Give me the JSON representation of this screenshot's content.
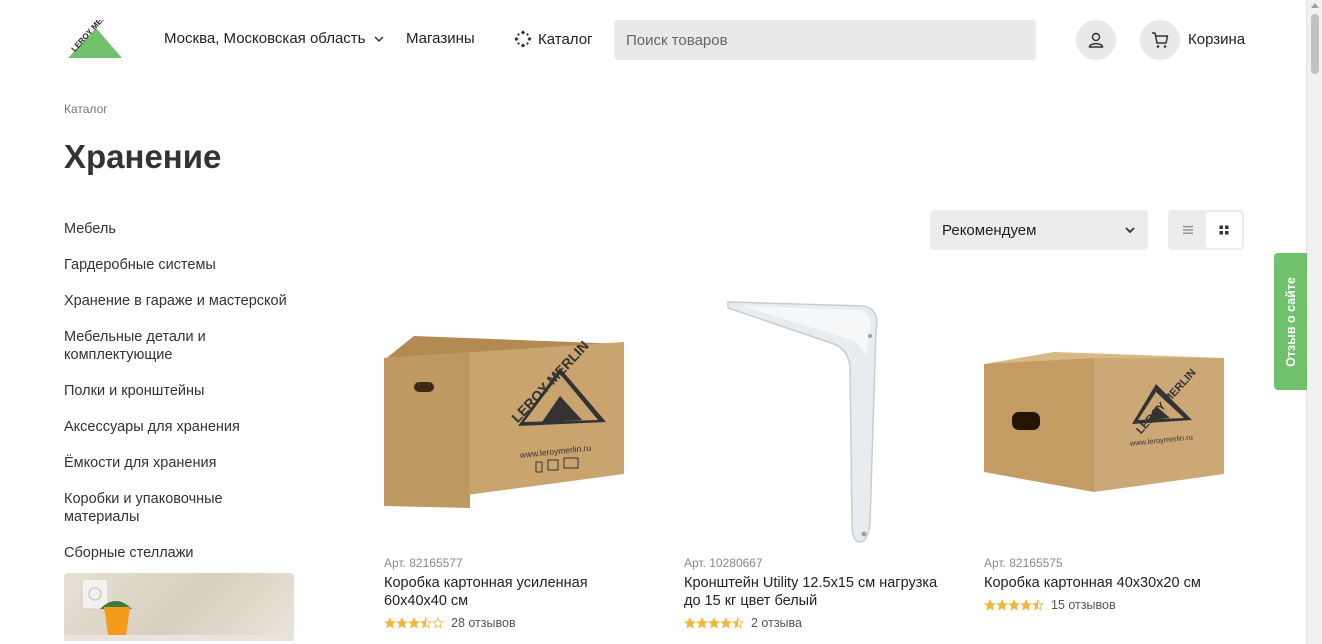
{
  "header": {
    "logo_text": "LEROY MERLIN",
    "region": "Москва, Московская область",
    "stores": "Магазины",
    "catalog": "Каталог",
    "search_placeholder": "Поиск товаров",
    "cart_label": "Корзина"
  },
  "breadcrumb": "Каталог",
  "page_title": "Хранение",
  "sidebar": {
    "items": [
      {
        "label": "Мебель"
      },
      {
        "label": "Гардеробные системы"
      },
      {
        "label": "Хранение в гараже и мастерской"
      },
      {
        "label": "Мебельные детали и комплектующие"
      },
      {
        "label": "Полки и кронштейны"
      },
      {
        "label": "Аксессуары для хранения"
      },
      {
        "label": "Ёмкости для хранения"
      },
      {
        "label": "Коробки и упаковочные материалы"
      },
      {
        "label": "Сборные стеллажи"
      }
    ]
  },
  "sort": {
    "selected": "Рекомендуем"
  },
  "view": {
    "active": "grid"
  },
  "products": [
    {
      "article": "Арт. 82165577",
      "name": "Коробка картонная усиленная 60x40x40 см",
      "rating": 3.5,
      "reviews": "28 отзывов",
      "box_text": "LEROY MERLIN",
      "box_url": "www.leroymerlin.ru"
    },
    {
      "article": "Арт. 10280667",
      "name": "Кронштейн Utility 12.5x15 см нагрузка до 15 кг цвет белый",
      "rating": 4.5,
      "reviews": "2 отзыва"
    },
    {
      "article": "Арт. 82165575",
      "name": "Коробка картонная 40x30x20 см",
      "rating": 4.5,
      "reviews": "15 отзывов",
      "box_text": "LEROY MERLIN",
      "box_url": "www.leroymerlin.ru"
    }
  ],
  "feedback_tab": "Отзыв о сайте",
  "colors": {
    "brand_green": "#6fc26b",
    "star": "#f2b53b",
    "cardboard": "#c9a46f"
  }
}
